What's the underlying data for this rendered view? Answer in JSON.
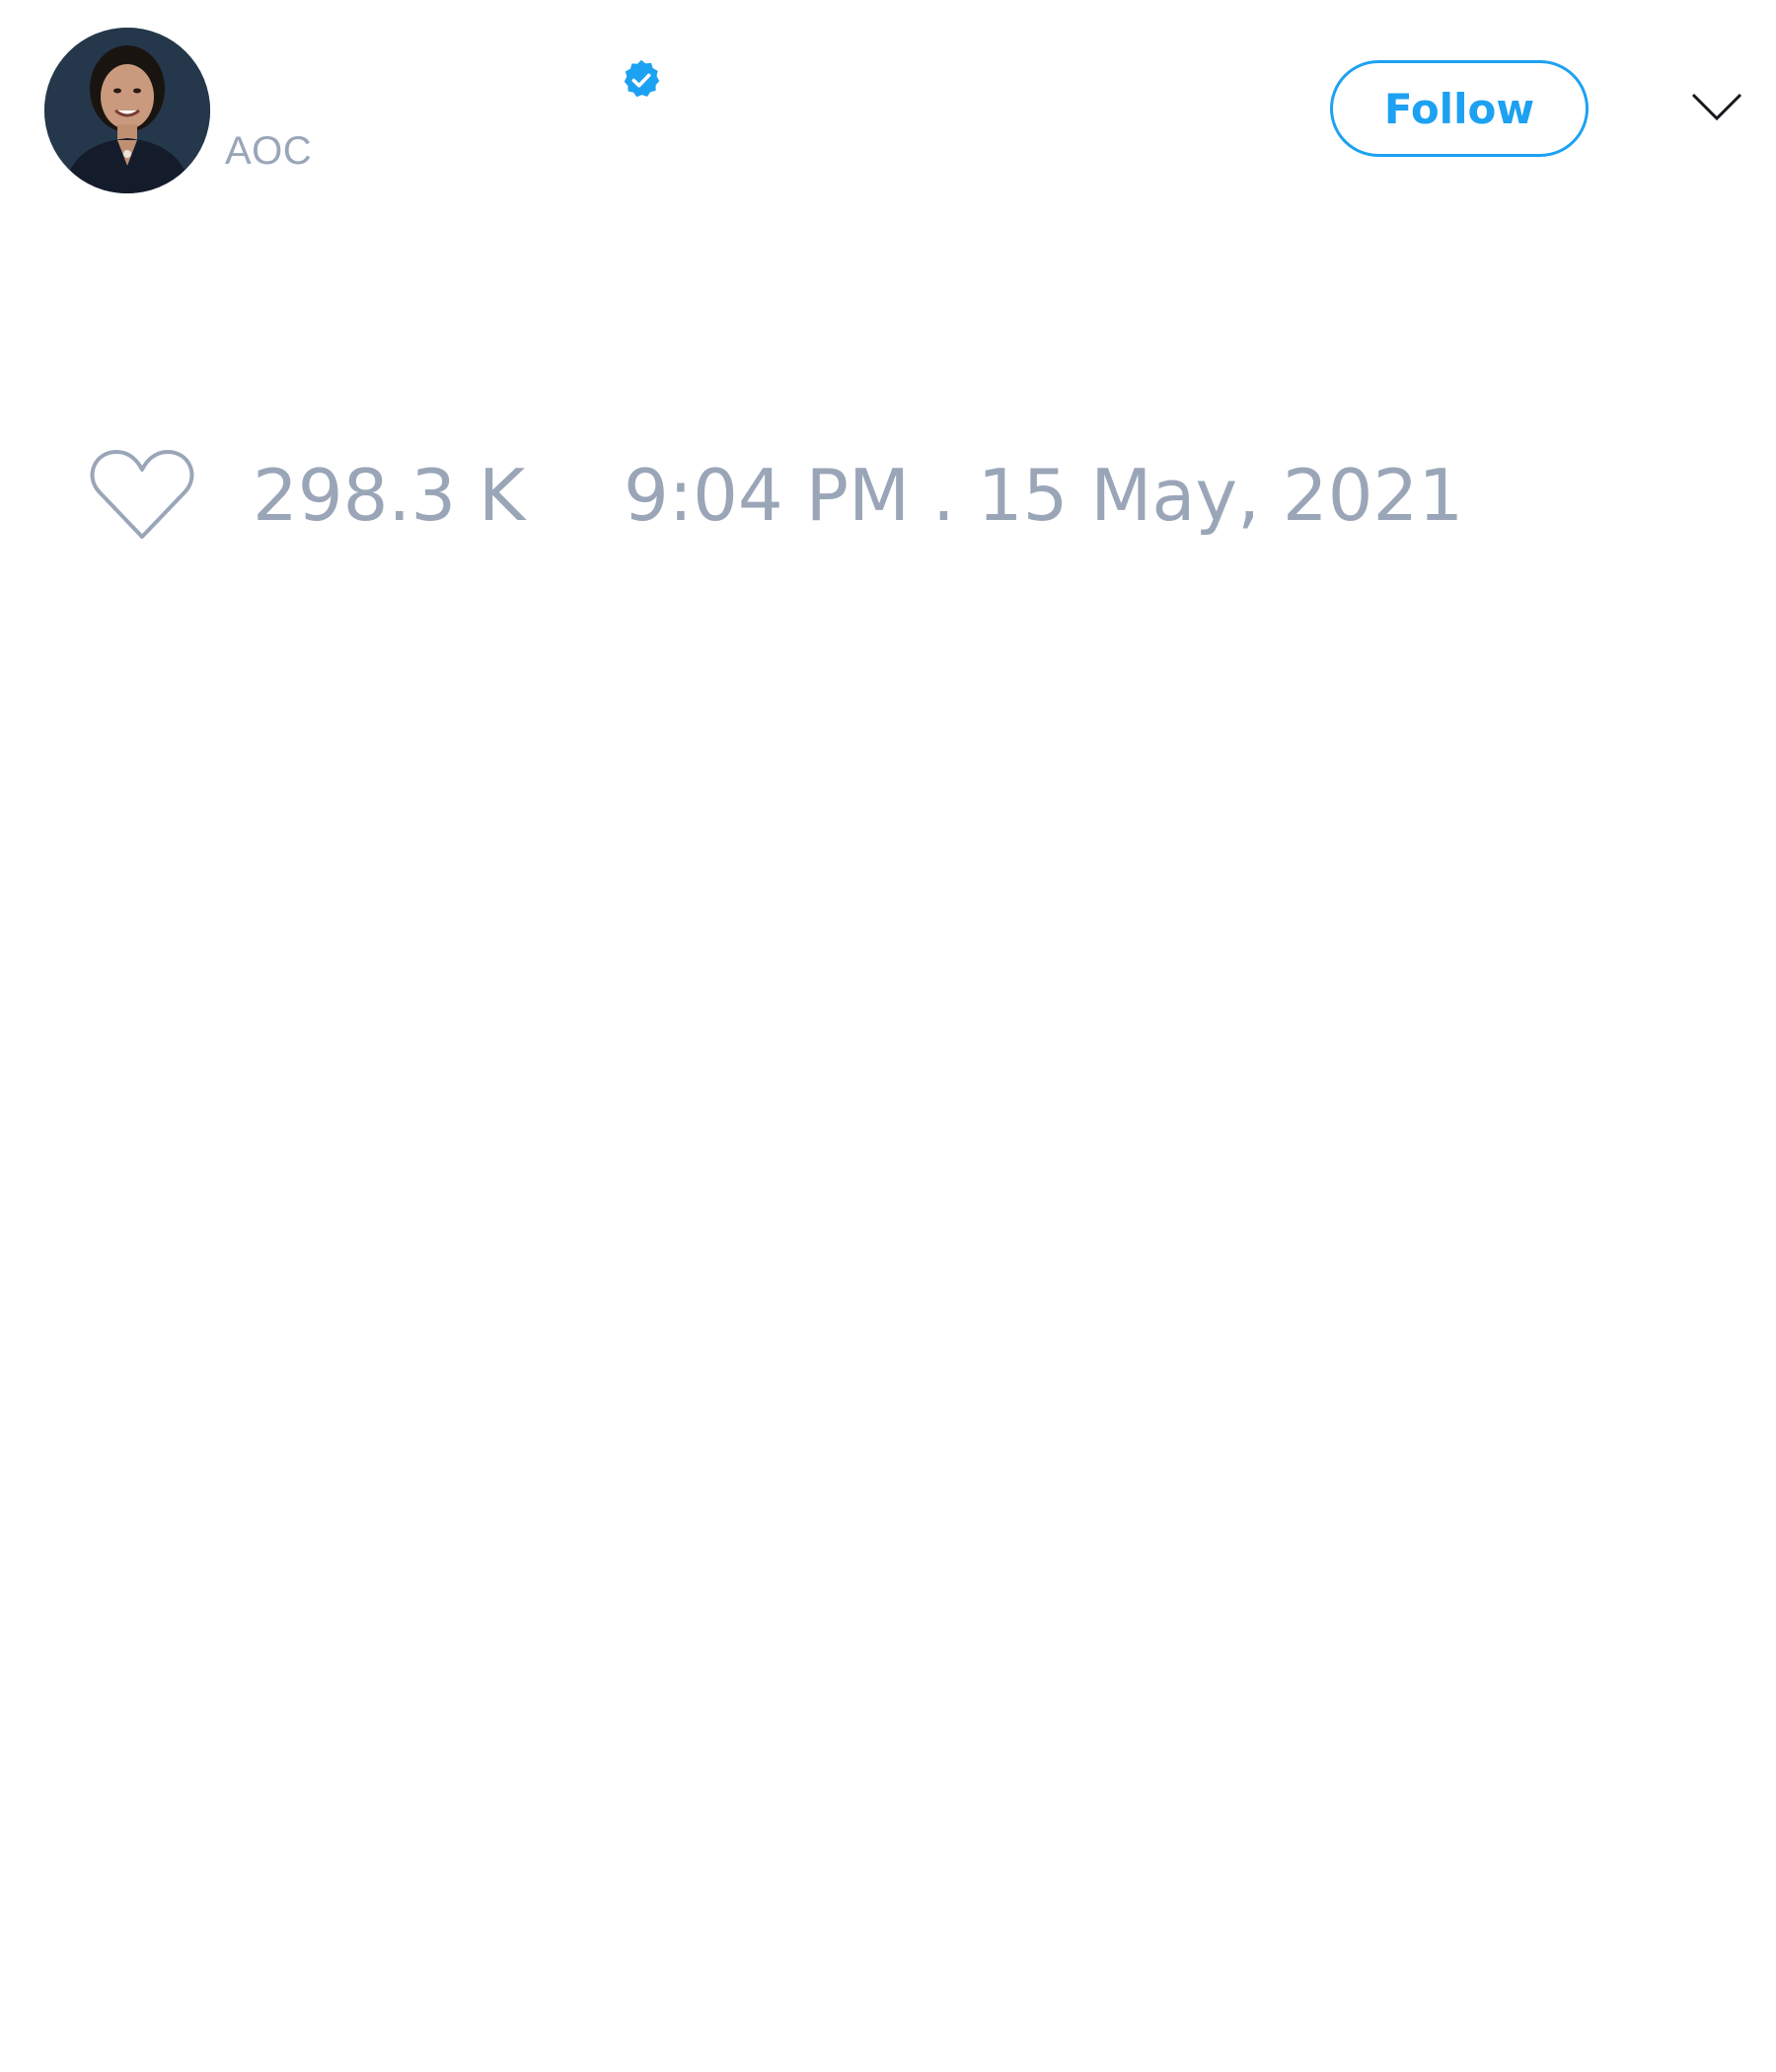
{
  "tweet": {
    "author": {
      "handle": "AOC",
      "verified": true,
      "avatar_icon": "profile-photo"
    },
    "header": {
      "follow_label": "Follow",
      "menu_icon": "chevron-down-icon"
    },
    "stats": {
      "like_icon": "heart-outline-icon",
      "like_count": "298.3 K",
      "timestamp": "9:04 PM . 15 May, 2021"
    }
  },
  "colors": {
    "accent": "#1da1f2",
    "muted_text": "#9aa6b8",
    "background": "#ffffff"
  }
}
